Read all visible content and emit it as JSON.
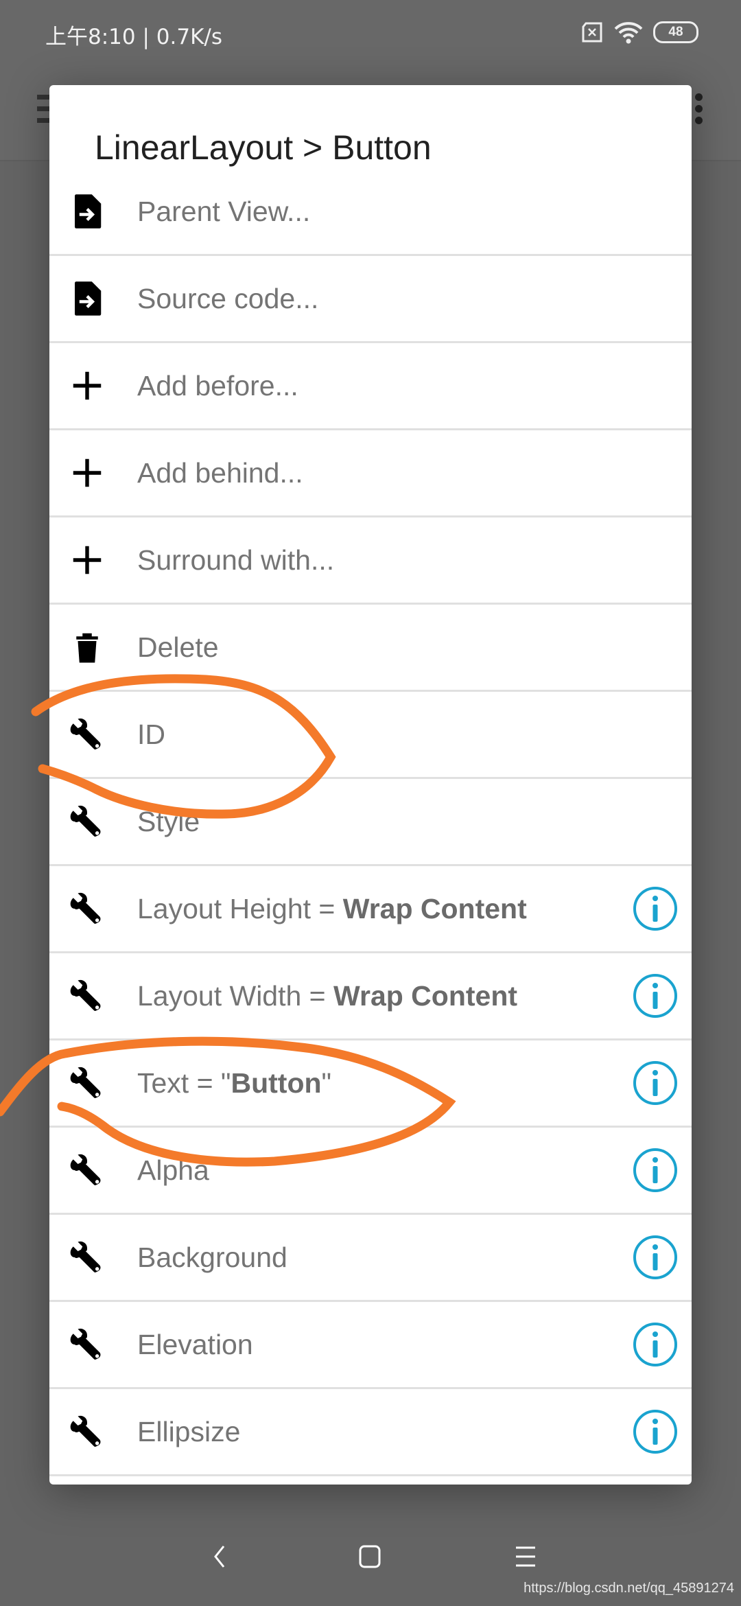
{
  "status_bar": {
    "time": "上午8:10",
    "speed": "0.7K/s",
    "battery": "48",
    "icons": [
      "sim-x-icon",
      "wifi-icon",
      "battery-icon"
    ]
  },
  "dialog": {
    "title": "LinearLayout > Button",
    "items": [
      {
        "icon": "file-arrow-icon",
        "label": "Parent View...",
        "bold": "",
        "suffix": "",
        "info": false
      },
      {
        "icon": "file-arrow-icon",
        "label": "Source code...",
        "bold": "",
        "suffix": "",
        "info": false
      },
      {
        "icon": "plus-icon",
        "label": "Add before...",
        "bold": "",
        "suffix": "",
        "info": false
      },
      {
        "icon": "plus-icon",
        "label": "Add behind...",
        "bold": "",
        "suffix": "",
        "info": false
      },
      {
        "icon": "plus-icon",
        "label": "Surround with...",
        "bold": "",
        "suffix": "",
        "info": false
      },
      {
        "icon": "trash-icon",
        "label": "Delete",
        "bold": "",
        "suffix": "",
        "info": false
      },
      {
        "icon": "wrench-icon",
        "label": "ID",
        "bold": "",
        "suffix": "",
        "info": false
      },
      {
        "icon": "wrench-icon",
        "label": "Style",
        "bold": "",
        "suffix": "",
        "info": false
      },
      {
        "icon": "wrench-icon",
        "label": "Layout Height = ",
        "bold": "Wrap Content",
        "suffix": "",
        "info": true
      },
      {
        "icon": "wrench-icon",
        "label": "Layout Width = ",
        "bold": "Wrap Content",
        "suffix": "",
        "info": true
      },
      {
        "icon": "wrench-icon",
        "label": "Text = \"",
        "bold": "Button",
        "suffix": "\"",
        "info": true
      },
      {
        "icon": "wrench-icon",
        "label": "Alpha",
        "bold": "",
        "suffix": "",
        "info": true
      },
      {
        "icon": "wrench-icon",
        "label": "Background",
        "bold": "",
        "suffix": "",
        "info": true
      },
      {
        "icon": "wrench-icon",
        "label": "Elevation",
        "bold": "",
        "suffix": "",
        "info": true
      },
      {
        "icon": "wrench-icon",
        "label": "Ellipsize",
        "bold": "",
        "suffix": "",
        "info": true
      }
    ]
  },
  "nav": {
    "icons": [
      "back-icon",
      "home-icon",
      "recents-icon"
    ]
  },
  "watermark": "https://blog.csdn.net/qq_45891274",
  "colors": {
    "accent_info": "#1aa3cf",
    "annotation": "#f47a2a",
    "text": "#747474"
  }
}
